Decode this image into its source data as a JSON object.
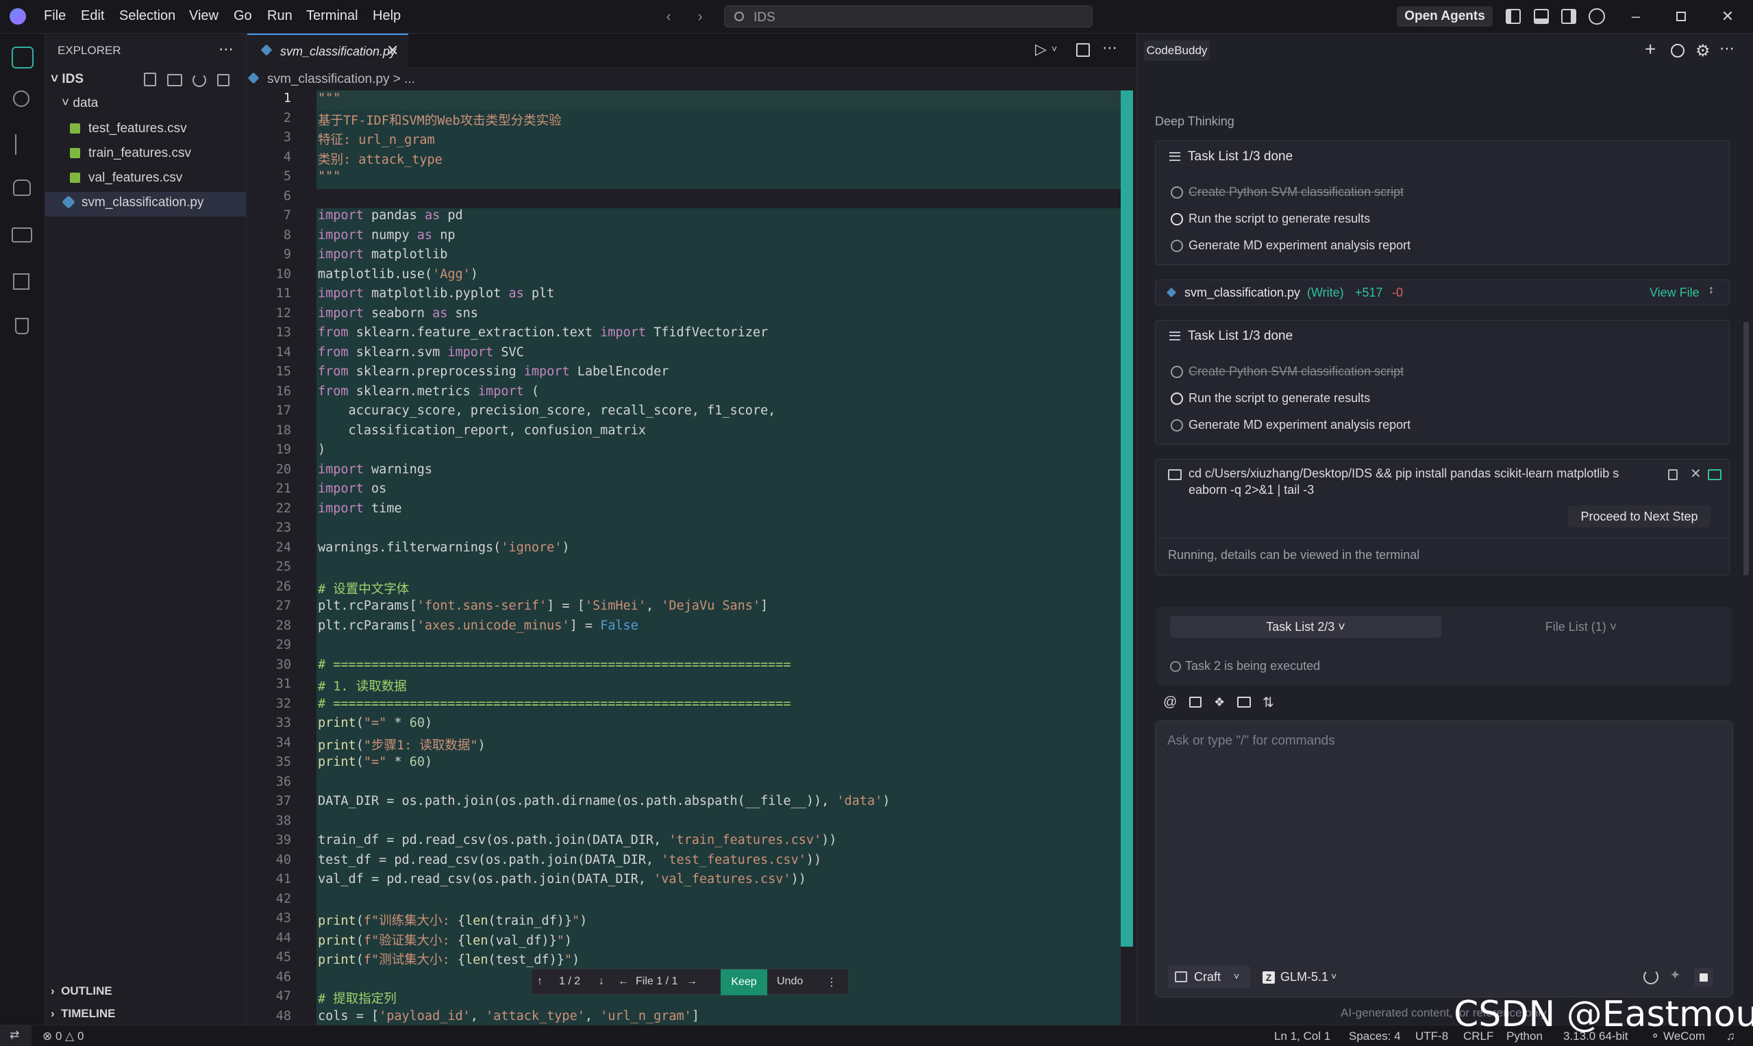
{
  "menu": [
    "File",
    "Edit",
    "Selection",
    "View",
    "Go",
    "Run",
    "Terminal",
    "Help"
  ],
  "search": {
    "placeholder": "IDS"
  },
  "open_agents": "Open Agents",
  "explorer": {
    "title": "EXPLORER",
    "root": "IDS",
    "folder": "data",
    "files": [
      "test_features.csv",
      "train_features.csv",
      "val_features.csv"
    ],
    "selected_file": "svm_classification.py"
  },
  "editor": {
    "tab": "svm_classification.py",
    "breadcrumb": "svm_classification.py > ...",
    "lines": [
      {
        "n": "1",
        "h": "<span class='str'>\"\"\"</span>"
      },
      {
        "n": "2",
        "h": "<span class='str'>基于TF-IDF和SVM的Web攻击类型分类实验</span>"
      },
      {
        "n": "3",
        "h": "<span class='str'>特征: url_n_gram</span>"
      },
      {
        "n": "4",
        "h": "<span class='str'>类别: attack_type</span>"
      },
      {
        "n": "5",
        "h": "<span class='str'>\"\"\"</span>"
      },
      {
        "n": "6",
        "h": ""
      },
      {
        "n": "7",
        "h": "<span class='kw'>import</span> pandas <span class='kw'>as</span> pd"
      },
      {
        "n": "8",
        "h": "<span class='kw'>import</span> numpy <span class='kw'>as</span> np"
      },
      {
        "n": "9",
        "h": "<span class='kw'>import</span> matplotlib"
      },
      {
        "n": "10",
        "h": "matplotlib.use(<span class='str'>'Agg'</span>)"
      },
      {
        "n": "11",
        "h": "<span class='kw'>import</span> matplotlib.pyplot <span class='kw'>as</span> plt"
      },
      {
        "n": "12",
        "h": "<span class='kw'>import</span> seaborn <span class='kw'>as</span> sns"
      },
      {
        "n": "13",
        "h": "<span class='kw'>from</span> sklearn.feature_extraction.text <span class='kw'>import</span> TfidfVectorizer"
      },
      {
        "n": "14",
        "h": "<span class='kw'>from</span> sklearn.svm <span class='kw'>import</span> SVC"
      },
      {
        "n": "15",
        "h": "<span class='kw'>from</span> sklearn.preprocessing <span class='kw'>import</span> LabelEncoder"
      },
      {
        "n": "16",
        "h": "<span class='kw'>from</span> sklearn.metrics <span class='kw'>import</span> ("
      },
      {
        "n": "17",
        "h": "    accuracy_score, precision_score, recall_score, f1_score,"
      },
      {
        "n": "18",
        "h": "    classification_report, confusion_matrix"
      },
      {
        "n": "19",
        "h": ")"
      },
      {
        "n": "20",
        "h": "<span class='kw'>import</span> warnings"
      },
      {
        "n": "21",
        "h": "<span class='kw'>import</span> os"
      },
      {
        "n": "22",
        "h": "<span class='kw'>import</span> time"
      },
      {
        "n": "23",
        "h": ""
      },
      {
        "n": "24",
        "h": "warnings.filterwarnings(<span class='str'>'ignore'</span>)"
      },
      {
        "n": "25",
        "h": ""
      },
      {
        "n": "26",
        "h": "<span class='cm'># 设置中文字体</span>"
      },
      {
        "n": "27",
        "h": "plt.rcParams[<span class='str'>'font.sans-serif'</span>] = [<span class='str'>'SimHei'</span>, <span class='str'>'DejaVu Sans'</span>]"
      },
      {
        "n": "28",
        "h": "plt.rcParams[<span class='str'>'axes.unicode_minus'</span>] = <span class='bl'>False</span>"
      },
      {
        "n": "29",
        "h": ""
      },
      {
        "n": "30",
        "h": "<span class='cm'># ============================================================</span>"
      },
      {
        "n": "31",
        "h": "<span class='cm'># 1. 读取数据</span>"
      },
      {
        "n": "32",
        "h": "<span class='cm'># ============================================================</span>"
      },
      {
        "n": "33",
        "h": "<span class='fn'>print</span>(<span class='str'>\"=\"</span> * <span class='num'>60</span>)"
      },
      {
        "n": "34",
        "h": "<span class='fn'>print</span>(<span class='str'>\"步骤1: 读取数据\"</span>)"
      },
      {
        "n": "35",
        "h": "<span class='fn'>print</span>(<span class='str'>\"=\"</span> * <span class='num'>60</span>)"
      },
      {
        "n": "36",
        "h": ""
      },
      {
        "n": "37",
        "h": "DATA_DIR = os.path.join(os.path.dirname(os.path.abspath(__file__)), <span class='str'>'data'</span>)"
      },
      {
        "n": "38",
        "h": ""
      },
      {
        "n": "39",
        "h": "train_df = pd.read_csv(os.path.join(DATA_DIR, <span class='str'>'train_features.csv'</span>))"
      },
      {
        "n": "40",
        "h": "test_df = pd.read_csv(os.path.join(DATA_DIR, <span class='str'>'test_features.csv'</span>))"
      },
      {
        "n": "41",
        "h": "val_df = pd.read_csv(os.path.join(DATA_DIR, <span class='str'>'val_features.csv'</span>))"
      },
      {
        "n": "42",
        "h": ""
      },
      {
        "n": "43",
        "h": "<span class='fn'>print</span>(<span class='str'>f\"训练集大小: </span>{<span class='fn'>len</span>(train_df)}<span class='str'>\"</span>)"
      },
      {
        "n": "44",
        "h": "<span class='fn'>print</span>(<span class='str'>f\"验证集大小: </span>{<span class='fn'>len</span>(val_df)}<span class='str'>\"</span>)"
      },
      {
        "n": "45",
        "h": "<span class='fn'>print</span>(<span class='str'>f\"测试集大小: </span>{<span class='fn'>len</span>(test_df)}<span class='str'>\"</span>)"
      },
      {
        "n": "46",
        "h": ""
      },
      {
        "n": "47",
        "h": "<span class='cm'># 提取指定列</span>"
      },
      {
        "n": "48",
        "h": "cols = [<span class='str'>'payload_id'</span>, <span class='str'>'attack_type'</span>, <span class='str'>'url_n_gram'</span>]"
      }
    ]
  },
  "diff_toolbar": {
    "nav": "1 / 2",
    "file": "File 1 / 1",
    "keep": "Keep",
    "undo": "Undo"
  },
  "right": {
    "tab": "CodeBuddy",
    "deep_thinking": "Deep Thinking",
    "task_list_title": "Task List 1/3 done",
    "tasks": [
      "Create Python SVM classification script",
      "Run the script to generate results",
      "Generate MD experiment analysis report"
    ],
    "file_card": {
      "name": "svm_classification.py",
      "mode": "(Write)",
      "added": "+517",
      "removed": "-0",
      "view": "View File"
    },
    "command": "cd c/Users/xiuzhang/Desktop/IDS && pip install pandas scikit-learn matplotlib s",
    "command2": "eaborn -q 2>&1 | tail -3",
    "proceed": "Proceed to Next Step",
    "running": "Running, details can be viewed in the terminal",
    "task_tab": "Task List 2/3",
    "file_tab": "File List (1)",
    "task_status": "Task 2 is being executed",
    "input_placeholder": "Ask or type \"/\" for commands",
    "mode": "Craft",
    "model": "GLM-5.1",
    "disclaimer": "AI-generated content, for reference only"
  },
  "statusbar": {
    "problems": "0",
    "warnings": "0",
    "position": "Ln 1, Col 1",
    "spaces": "Spaces: 4",
    "encoding": "UTF-8",
    "eol": "CRLF",
    "language": "Python",
    "version": "3.13.0 64-bit",
    "wecom": "WeCom"
  },
  "watermark": "CSDN @Eastmount"
}
